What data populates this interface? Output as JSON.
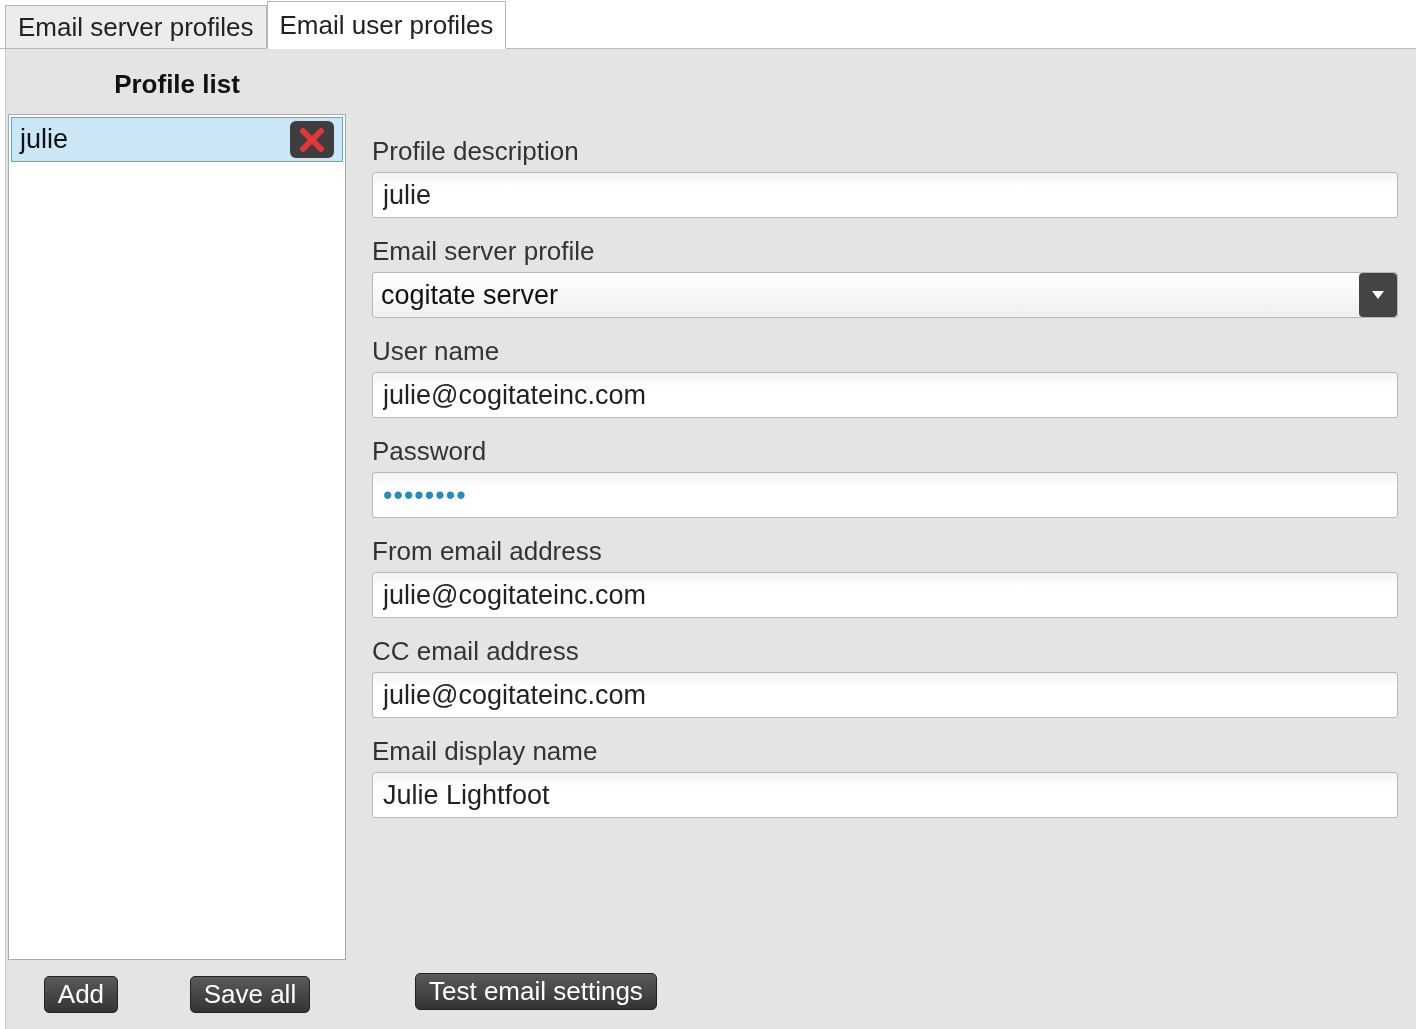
{
  "tabs": [
    {
      "label": "Email server profiles",
      "selected": false
    },
    {
      "label": "Email user profiles",
      "selected": true
    }
  ],
  "profile_list": {
    "title": "Profile list",
    "items": [
      {
        "label": "julie",
        "selected": true
      }
    ],
    "buttons": [
      "Add",
      "Save all"
    ]
  },
  "fields": [
    {
      "kind": "text",
      "label": "Profile description",
      "value": "julie"
    },
    {
      "kind": "select",
      "label": "Email server profile",
      "value": "cogitate server"
    },
    {
      "kind": "text",
      "label": "User name",
      "value": "julie@cogitateinc.com"
    },
    {
      "kind": "password",
      "label": "Password",
      "value": "••••••••"
    },
    {
      "kind": "text",
      "label": "From email address",
      "value": "julie@cogitateinc.com"
    },
    {
      "kind": "text",
      "label": "CC email address",
      "value": "julie@cogitateinc.com"
    },
    {
      "kind": "text",
      "label": "Email display name",
      "value": "Julie Lightfoot"
    }
  ],
  "test_button": "Test email settings"
}
